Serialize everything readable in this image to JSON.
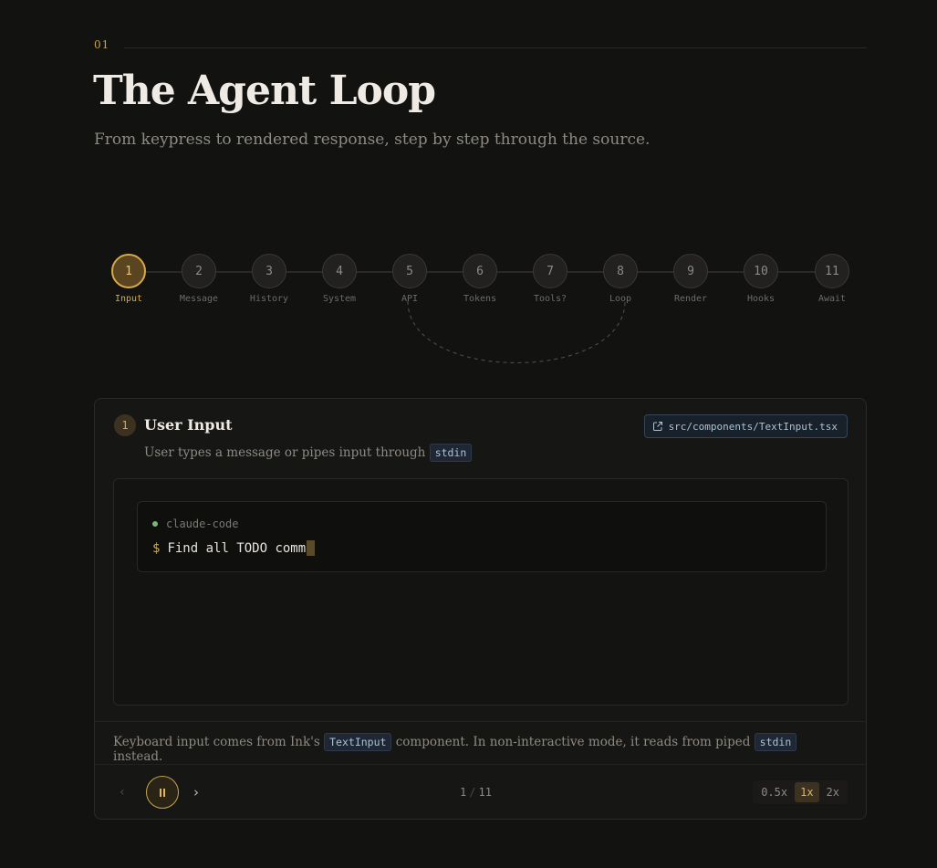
{
  "section": {
    "number": "01"
  },
  "title": "The Agent Loop",
  "subtitle": "From keypress to rendered response, step by step through the source.",
  "steps": [
    {
      "num": "1",
      "label": "Input"
    },
    {
      "num": "2",
      "label": "Message"
    },
    {
      "num": "3",
      "label": "History"
    },
    {
      "num": "4",
      "label": "System"
    },
    {
      "num": "5",
      "label": "API"
    },
    {
      "num": "6",
      "label": "Tokens"
    },
    {
      "num": "7",
      "label": "Tools?"
    },
    {
      "num": "8",
      "label": "Loop"
    },
    {
      "num": "9",
      "label": "Render"
    },
    {
      "num": "10",
      "label": "Hooks"
    },
    {
      "num": "11",
      "label": "Await"
    }
  ],
  "active_step": 1,
  "card": {
    "badge": "1",
    "title": "User Input",
    "desc_text": "User types a message or pipes input through",
    "desc_code": "stdin",
    "file_link": "src/components/TextInput.tsx",
    "terminal": {
      "title": "claude-code",
      "prompt": "$",
      "input": "Find all TODO comm"
    },
    "explanation": {
      "part1": "Keyboard input comes from Ink's",
      "code1": "TextInput",
      "part2": "component. In non-interactive mode, it reads from piped",
      "code2": "stdin",
      "part3": "instead."
    }
  },
  "controls": {
    "prev": "‹",
    "next": "›",
    "current": "1",
    "separator": "/",
    "total": "11",
    "speeds": [
      "0.5x",
      "1x",
      "2x"
    ],
    "active_speed": "1x"
  },
  "colors": {
    "accent": "#d6a94a",
    "background": "#121211",
    "code_chip": "#a9c3d8"
  }
}
